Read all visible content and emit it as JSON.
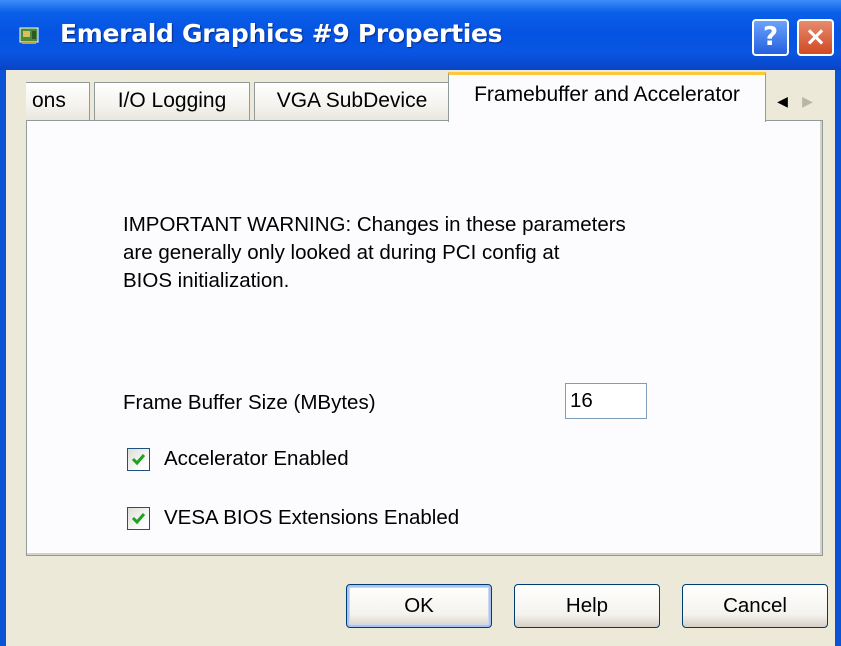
{
  "window": {
    "title": "Emerald Graphics #9 Properties",
    "help_button": "?",
    "close_button": "×"
  },
  "tabs": {
    "partial_label": "ons",
    "items": [
      {
        "label": "I/O Logging"
      },
      {
        "label": "VGA SubDevice"
      }
    ],
    "active_label": "Framebuffer and Accelerator",
    "scroll_left": "◀",
    "scroll_right": "▶"
  },
  "page": {
    "warning_lines": [
      "IMPORTANT WARNING:  Changes in these parameters",
      "are generally only looked at during PCI config at",
      "BIOS initialization."
    ],
    "frame_buffer_label": "Frame Buffer Size (MBytes)",
    "frame_buffer_value": "16",
    "accelerator_label": "Accelerator Enabled",
    "accelerator_checked": true,
    "vesa_label": "VESA BIOS Extensions Enabled",
    "vesa_checked": true
  },
  "buttons": {
    "ok": "OK",
    "help": "Help",
    "cancel": "Cancel"
  },
  "colors": {
    "titlebar": "#0553e3",
    "dialog_bg": "#ece9d8",
    "active_tab_accent": "#ffc83c",
    "checkmark": "#21a121"
  }
}
